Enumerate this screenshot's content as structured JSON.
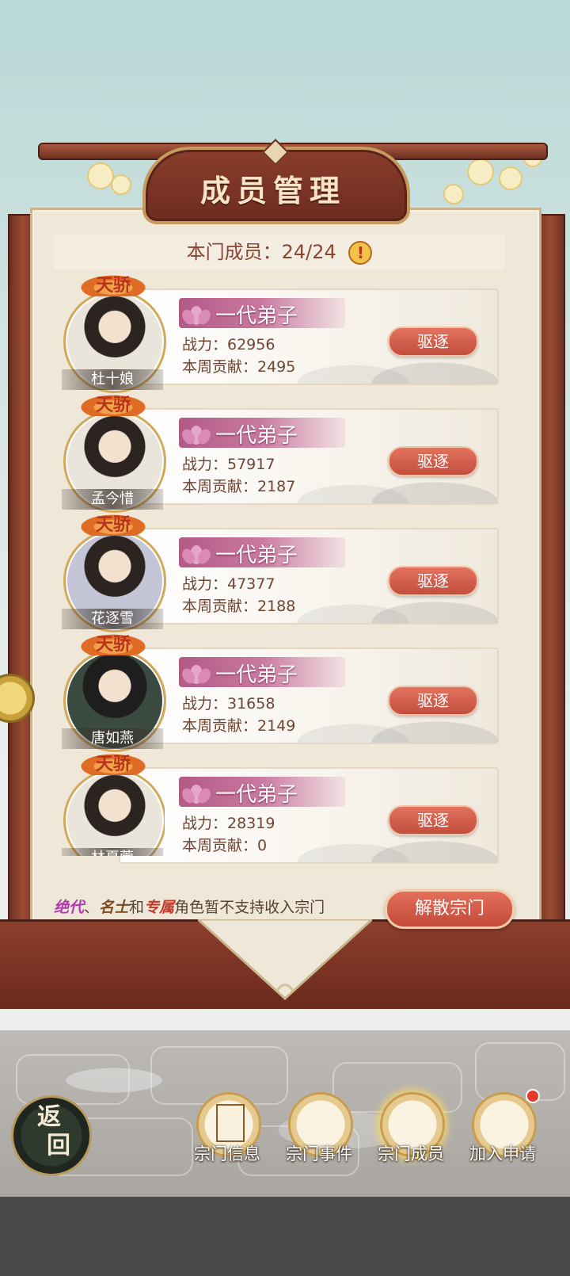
{
  "panel": {
    "title": "成员管理",
    "member_count_label": "本门成员：24/24",
    "warn_glyph": "!"
  },
  "members": [
    {
      "badge": "天骄",
      "name": "杜十娘",
      "rank": "一代弟子",
      "power_label": "战力：62956",
      "weekly_label": "本周贡献：2495",
      "expel": "驱逐"
    },
    {
      "badge": "天骄",
      "name": "孟今惜",
      "rank": "一代弟子",
      "power_label": "战力：57917",
      "weekly_label": "本周贡献：2187",
      "expel": "驱逐"
    },
    {
      "badge": "天骄",
      "name": "花逐雪",
      "rank": "一代弟子",
      "power_label": "战力：47377",
      "weekly_label": "本周贡献：2188",
      "expel": "驱逐"
    },
    {
      "badge": "天骄",
      "name": "唐如燕",
      "rank": "一代弟子",
      "power_label": "战力：31658",
      "weekly_label": "本周贡献：2149",
      "expel": "驱逐"
    },
    {
      "badge": "天骄",
      "name": "林夏萱",
      "rank": "一代弟子",
      "power_label": "战力：28319",
      "weekly_label": "本周贡献：0",
      "expel": "驱逐"
    }
  ],
  "notice": {
    "t1": "绝代",
    "sep1": "、",
    "t2": "名士",
    "and": "和",
    "t3": "专属",
    "rest": "角色暂不支持收入宗门"
  },
  "disband_label": "解散宗门",
  "back_label_1": "返",
  "back_label_2": "回",
  "nav": [
    {
      "label": "宗门信息",
      "icon": "scroll-icon"
    },
    {
      "label": "宗门事件",
      "icon": "brush-icon"
    },
    {
      "label": "宗门成员",
      "icon": "members-icon"
    },
    {
      "label": "加入申请",
      "icon": "application-book-icon"
    }
  ],
  "colors": {
    "frame_wood": "#7a3526",
    "button_red": "#d25c4a",
    "rank_ribbon": "#b25a86",
    "panel_paper": "#efe7d8"
  }
}
